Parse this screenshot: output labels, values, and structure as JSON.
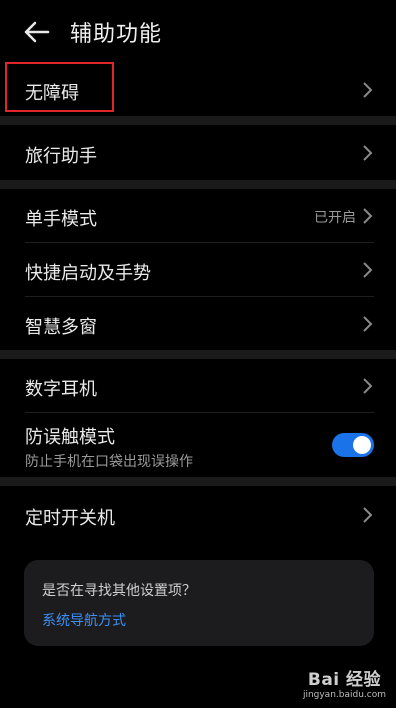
{
  "header": {
    "title": "辅助功能"
  },
  "groups": {
    "g1": {
      "label": "无障碍"
    },
    "g2": {
      "label": "旅行助手"
    },
    "g3": [
      {
        "label": "单手模式",
        "value": "已开启"
      },
      {
        "label": "快捷启动及手势"
      },
      {
        "label": "智慧多窗"
      }
    ],
    "g4": [
      {
        "label": "数字耳机"
      },
      {
        "label": "防误触模式",
        "sublabel": "防止手机在口袋出现误操作",
        "toggle": "on"
      }
    ],
    "g5": {
      "label": "定时开关机"
    }
  },
  "suggestion": {
    "question": "是否在寻找其他设置项？",
    "link": "系统导航方式"
  },
  "watermark": {
    "brand": "Bai 经验",
    "url": "jingyan.baidu.com"
  },
  "colors": {
    "accent": "#1a73e8",
    "link": "#3d8ff5",
    "highlight": "#e0262b"
  }
}
